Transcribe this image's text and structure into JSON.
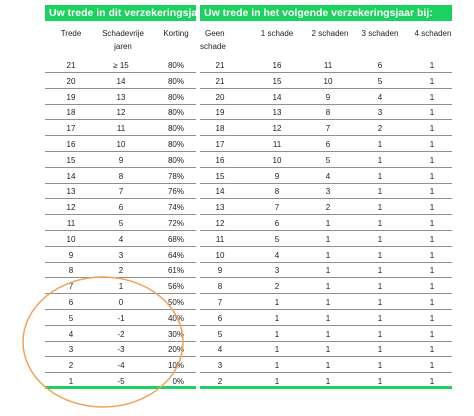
{
  "headers": {
    "current_year": "Uw trede in dit verzekeringsjaar",
    "next_year": "Uw trede in het volgende verzekeringsjaar bij:"
  },
  "columns": {
    "trede": "Trede",
    "schadevrije_line1": "Schadevrije",
    "schadevrije_line2": "jaren",
    "korting": "Korting",
    "geen_line1": "Geen",
    "geen_line2": "schade",
    "s1": "1 schade",
    "s2": "2 schaden",
    "s3": "3 schaden",
    "s4": "4 schaden"
  },
  "rows": [
    {
      "trede": "21",
      "jaren": "≥ 15",
      "korting": "80%",
      "geen": "21",
      "s1": "16",
      "s2": "11",
      "s3": "6",
      "s4": "1"
    },
    {
      "trede": "20",
      "jaren": "14",
      "korting": "80%",
      "geen": "21",
      "s1": "15",
      "s2": "10",
      "s3": "5",
      "s4": "1"
    },
    {
      "trede": "19",
      "jaren": "13",
      "korting": "80%",
      "geen": "20",
      "s1": "14",
      "s2": "9",
      "s3": "4",
      "s4": "1"
    },
    {
      "trede": "18",
      "jaren": "12",
      "korting": "80%",
      "geen": "19",
      "s1": "13",
      "s2": "8",
      "s3": "3",
      "s4": "1"
    },
    {
      "trede": "17",
      "jaren": "11",
      "korting": "80%",
      "geen": "18",
      "s1": "12",
      "s2": "7",
      "s3": "2",
      "s4": "1"
    },
    {
      "trede": "16",
      "jaren": "10",
      "korting": "80%",
      "geen": "17",
      "s1": "11",
      "s2": "6",
      "s3": "1",
      "s4": "1"
    },
    {
      "trede": "15",
      "jaren": "9",
      "korting": "80%",
      "geen": "16",
      "s1": "10",
      "s2": "5",
      "s3": "1",
      "s4": "1"
    },
    {
      "trede": "14",
      "jaren": "8",
      "korting": "78%",
      "geen": "15",
      "s1": "9",
      "s2": "4",
      "s3": "1",
      "s4": "1"
    },
    {
      "trede": "13",
      "jaren": "7",
      "korting": "76%",
      "geen": "14",
      "s1": "8",
      "s2": "3",
      "s3": "1",
      "s4": "1"
    },
    {
      "trede": "12",
      "jaren": "6",
      "korting": "74%",
      "geen": "13",
      "s1": "7",
      "s2": "2",
      "s3": "1",
      "s4": "1"
    },
    {
      "trede": "11",
      "jaren": "5",
      "korting": "72%",
      "geen": "12",
      "s1": "6",
      "s2": "1",
      "s3": "1",
      "s4": "1"
    },
    {
      "trede": "10",
      "jaren": "4",
      "korting": "68%",
      "geen": "11",
      "s1": "5",
      "s2": "1",
      "s3": "1",
      "s4": "1"
    },
    {
      "trede": "9",
      "jaren": "3",
      "korting": "64%",
      "geen": "10",
      "s1": "4",
      "s2": "1",
      "s3": "1",
      "s4": "1"
    },
    {
      "trede": "8",
      "jaren": "2",
      "korting": "61%",
      "geen": "9",
      "s1": "3",
      "s2": "1",
      "s3": "1",
      "s4": "1"
    },
    {
      "trede": "7",
      "jaren": "1",
      "korting": "56%",
      "geen": "8",
      "s1": "2",
      "s2": "1",
      "s3": "1",
      "s4": "1"
    },
    {
      "trede": "6",
      "jaren": "0",
      "korting": "50%",
      "geen": "7",
      "s1": "1",
      "s2": "1",
      "s3": "1",
      "s4": "1"
    },
    {
      "trede": "5",
      "jaren": "-1",
      "korting": "40%",
      "geen": "6",
      "s1": "1",
      "s2": "1",
      "s3": "1",
      "s4": "1"
    },
    {
      "trede": "4",
      "jaren": "-2",
      "korting": "30%",
      "geen": "5",
      "s1": "1",
      "s2": "1",
      "s3": "1",
      "s4": "1"
    },
    {
      "trede": "3",
      "jaren": "-3",
      "korting": "20%",
      "geen": "4",
      "s1": "1",
      "s2": "1",
      "s3": "1",
      "s4": "1"
    },
    {
      "trede": "2",
      "jaren": "-4",
      "korting": "10%",
      "geen": "3",
      "s1": "1",
      "s2": "1",
      "s3": "1",
      "s4": "1"
    },
    {
      "trede": "1",
      "jaren": "-5",
      "korting": "0%",
      "geen": "2",
      "s1": "1",
      "s2": "1",
      "s3": "1",
      "s4": "1"
    }
  ],
  "colors": {
    "header_green": "#1bd15f",
    "annotation_orange": "#f0a15a",
    "row_line": "#8f8f8f"
  }
}
